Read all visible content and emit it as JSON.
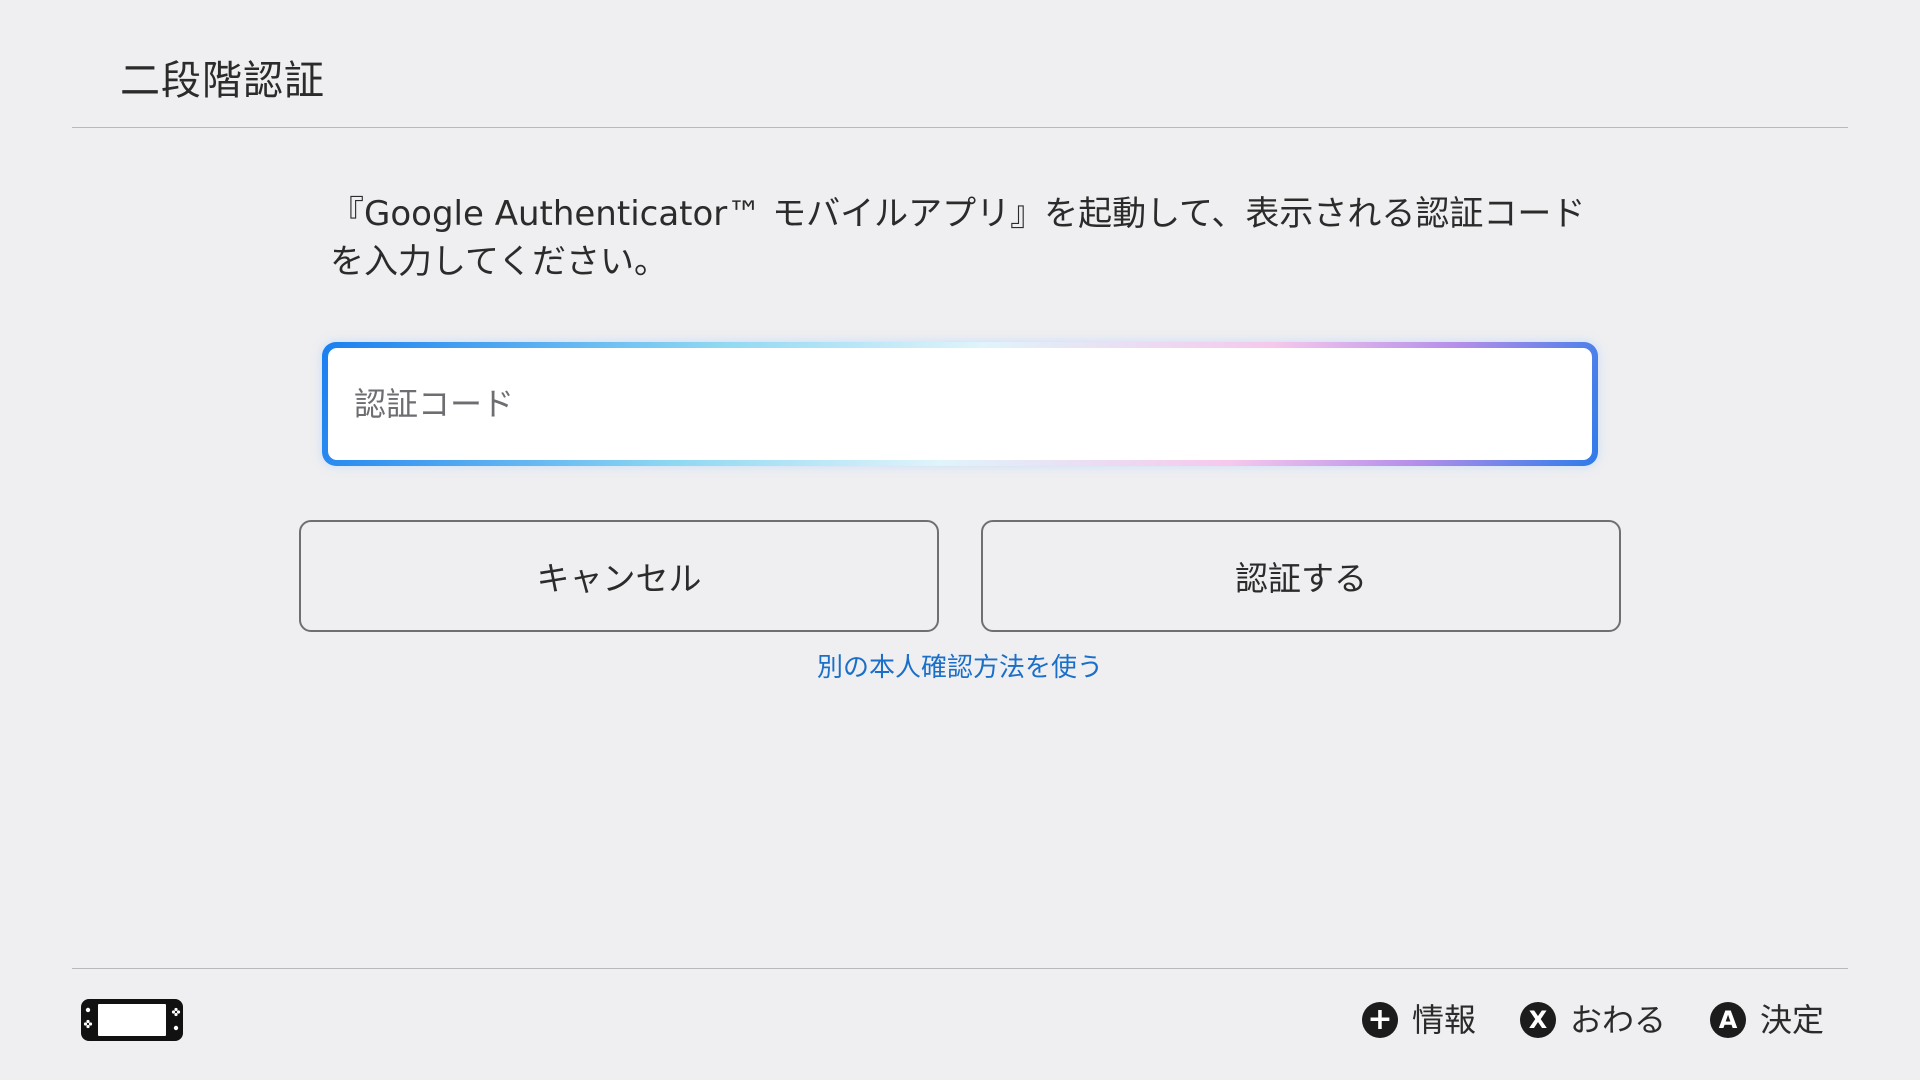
{
  "header": {
    "title": "二段階認証"
  },
  "main": {
    "instruction": "『Google Authenticator™ モバイルアプリ』を起動して、表示される認証コードを入力してください。",
    "code_input": {
      "value": "",
      "placeholder": "認証コード"
    },
    "cancel_label": "キャンセル",
    "verify_label": "認証する",
    "alt_method_link": "別の本人確認方法を使う"
  },
  "footer": {
    "console_icon": "handheld-console-icon",
    "hints": [
      {
        "button": "+",
        "icon": "plus-button-icon",
        "label": "情報"
      },
      {
        "button": "X",
        "icon": "x-button-icon",
        "label": "おわる"
      },
      {
        "button": "A",
        "icon": "a-button-icon",
        "label": "決定"
      }
    ]
  },
  "colors": {
    "background": "#efeff1",
    "text": "#2b2b2b",
    "link": "#1a6fc9",
    "input_accent_start": "#1a7ff0",
    "input_accent_end": "#2d7bea"
  }
}
